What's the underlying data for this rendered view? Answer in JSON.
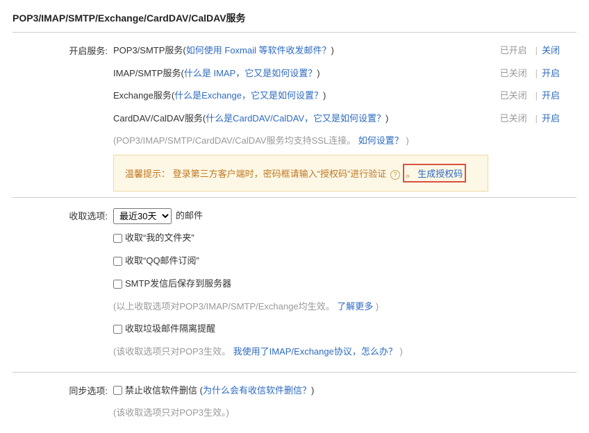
{
  "title": "POP3/IMAP/SMTP/Exchange/CardDAV/CalDAV服务",
  "labels": {
    "enable_service": "开启服务:",
    "receive_options": "收取选项:",
    "sync_options": "同步选项:"
  },
  "services": {
    "pop3": {
      "name": "POP3/SMTP服务",
      "help": "如何使用 Foxmail 等软件收发邮件？",
      "status": "已开启",
      "action": "关闭"
    },
    "imap": {
      "name": "IMAP/SMTP服务",
      "help": "什么是 IMAP，它又是如何设置？",
      "status": "已关闭",
      "action": "开启"
    },
    "exchange": {
      "name": "Exchange服务",
      "help": "什么是Exchange，它又是如何设置？",
      "status": "已关闭",
      "action": "开启"
    },
    "carddav": {
      "name": "CardDAV/CalDAV服务",
      "help": "什么是CardDAV/CalDAV，它又是如何设置？",
      "status": "已关闭",
      "action": "开启"
    }
  },
  "ssl": {
    "prefix": "(POP3/IMAP/SMTP/CardDAV/CalDAV服务均支持SSL连接。",
    "link": "如何设置？",
    "suffix": ")"
  },
  "tip": {
    "label": "温馨提示：",
    "text": "登录第三方客户端时，密码框请输入“授权码”进行验证",
    "help_symbol": "?",
    "period": "。",
    "link": "生成授权码"
  },
  "receive": {
    "select_value": "最近30天",
    "select_suffix": "的邮件",
    "chk_myfolder": "收取“我的文件夹”",
    "chk_qqsub": "收取“QQ邮件订阅”",
    "chk_smtp_save": "SMTP发信后保存到服务器",
    "hint_prefix": "(以上收取选项对POP3/IMAP/SMTP/Exchange均生效。",
    "hint_link": "了解更多",
    "hint_suffix": ")",
    "chk_spam": "收取垃圾邮件隔离提醒",
    "hint2_prefix": "(该收取选项只对POP3生效。",
    "hint2_link": "我使用了IMAP/Exchange协议，怎么办？",
    "hint2_suffix": ")"
  },
  "sync": {
    "chk_forbid_delete": "禁止收信软件删信",
    "help_link": "为什么会有收信软件删信？",
    "hint": "(该收取选项只对POP3生效。)"
  }
}
